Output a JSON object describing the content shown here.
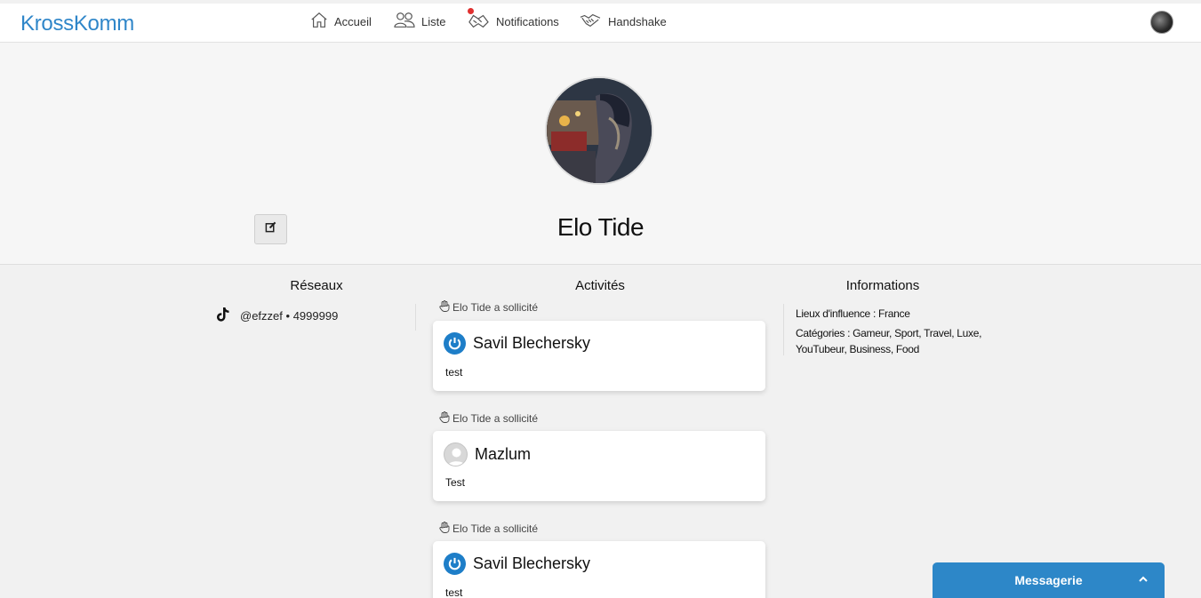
{
  "navbar": {
    "brand": "KrossKomm",
    "items": [
      {
        "label": "Accueil",
        "icon": "home-icon"
      },
      {
        "label": "Liste",
        "icon": "users-icon"
      },
      {
        "label": "Notifications",
        "icon": "bell-icon",
        "has_badge": true
      },
      {
        "label": "Handshake",
        "icon": "handshake-icon"
      }
    ]
  },
  "profile": {
    "name": "Elo Tide"
  },
  "reseaux": {
    "title": "Réseaux",
    "networks": [
      {
        "icon": "tiktok-icon",
        "handle": "@efzzef",
        "separator": "•",
        "followers": "4999999"
      }
    ]
  },
  "activites": {
    "title": "Activités",
    "items": [
      {
        "label": "Elo Tide a sollicité",
        "name": "Savil Blechersky",
        "avatar": "power-icon",
        "text": "test"
      },
      {
        "label": "Elo Tide a sollicité",
        "name": "Mazlum",
        "avatar": "default-avatar",
        "text": "Test"
      },
      {
        "label": "Elo Tide a sollicité",
        "name": "Savil Blechersky",
        "avatar": "power-icon",
        "text": "test"
      }
    ]
  },
  "informations": {
    "title": "Informations",
    "lieux": "Lieux d'influence : France",
    "categories": "Catégories : Gameur, Sport, Travel, Luxe, YouTubeur, Business, Food"
  },
  "messagerie": {
    "label": "Messagerie"
  },
  "colors": {
    "brand": "#2f86c9",
    "messagerie": "#2d87c8",
    "notification_badge": "#e0302f",
    "power_avatar": "#1e7ec8"
  }
}
